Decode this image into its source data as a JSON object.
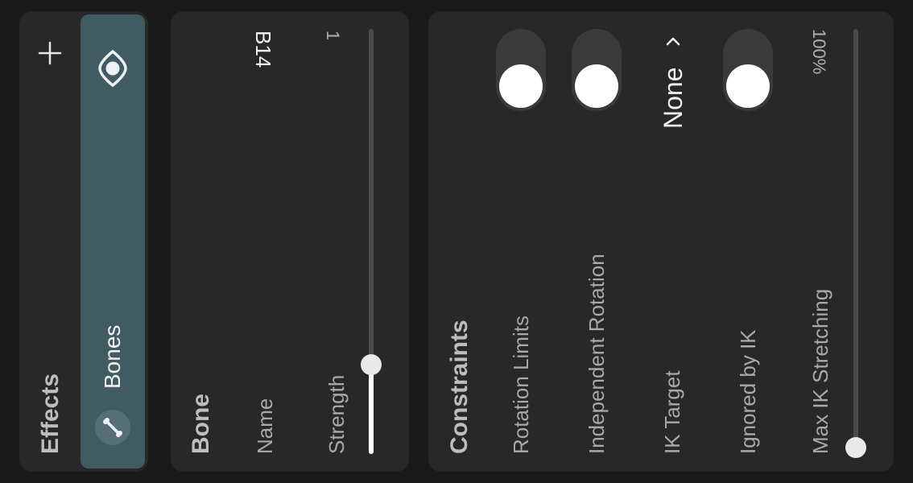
{
  "effects_panel": {
    "title": "Effects",
    "add_icon": "plus-icon",
    "layer": {
      "label": "Bones",
      "icon": "bone-icon",
      "visibility_icon": "eye-icon",
      "selected_color": "#415b63"
    }
  },
  "bone_panel": {
    "title": "Bone",
    "name_label": "Name",
    "name_value": "B14",
    "strength_label": "Strength",
    "strength_value": "1",
    "strength_fraction": 0.21
  },
  "constraints_panel": {
    "title": "Constraints",
    "rotation_limits_label": "Rotation Limits",
    "rotation_limits_on": false,
    "independent_rotation_label": "Independent Rotation",
    "independent_rotation_on": false,
    "ik_target_label": "IK Target",
    "ik_target_value": "None",
    "ik_target_icon": "chevron-up-icon",
    "ignored_by_ik_label": "Ignored by IK",
    "ignored_by_ik_on": false,
    "max_ik_stretching_label": "Max IK Stretching",
    "max_ik_stretching_value": "100%",
    "max_ik_stretching_fraction": 0.0
  }
}
